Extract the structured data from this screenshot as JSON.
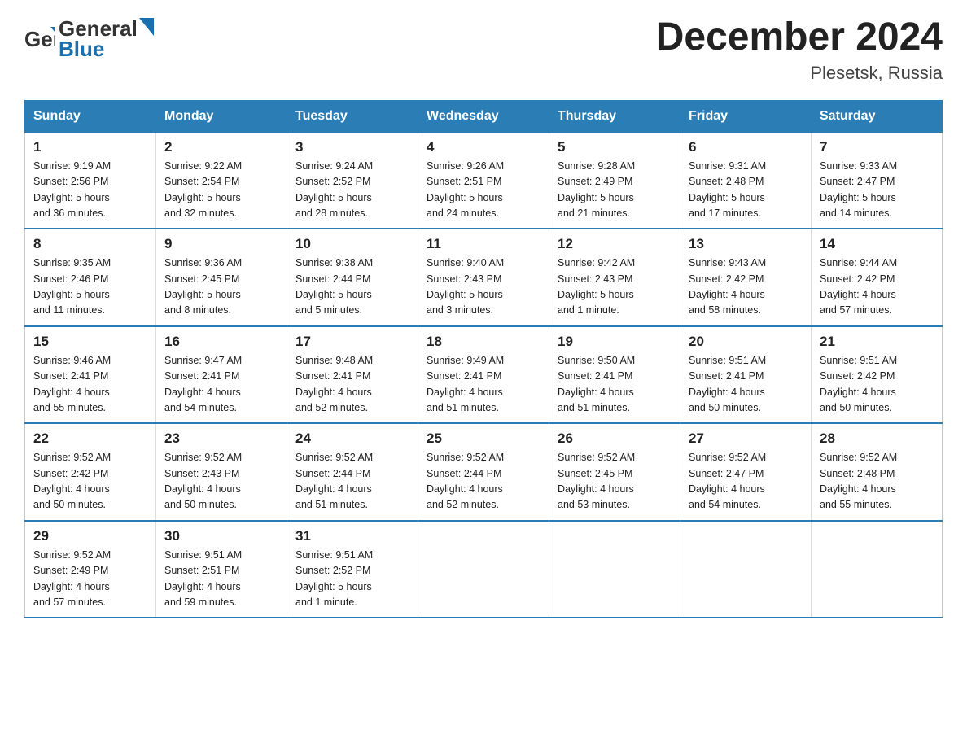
{
  "header": {
    "logo_general": "General",
    "logo_blue": "Blue",
    "month_title": "December 2024",
    "location": "Plesetsk, Russia"
  },
  "days_of_week": [
    "Sunday",
    "Monday",
    "Tuesday",
    "Wednesday",
    "Thursday",
    "Friday",
    "Saturday"
  ],
  "weeks": [
    [
      {
        "day": "1",
        "info": "Sunrise: 9:19 AM\nSunset: 2:56 PM\nDaylight: 5 hours\nand 36 minutes."
      },
      {
        "day": "2",
        "info": "Sunrise: 9:22 AM\nSunset: 2:54 PM\nDaylight: 5 hours\nand 32 minutes."
      },
      {
        "day": "3",
        "info": "Sunrise: 9:24 AM\nSunset: 2:52 PM\nDaylight: 5 hours\nand 28 minutes."
      },
      {
        "day": "4",
        "info": "Sunrise: 9:26 AM\nSunset: 2:51 PM\nDaylight: 5 hours\nand 24 minutes."
      },
      {
        "day": "5",
        "info": "Sunrise: 9:28 AM\nSunset: 2:49 PM\nDaylight: 5 hours\nand 21 minutes."
      },
      {
        "day": "6",
        "info": "Sunrise: 9:31 AM\nSunset: 2:48 PM\nDaylight: 5 hours\nand 17 minutes."
      },
      {
        "day": "7",
        "info": "Sunrise: 9:33 AM\nSunset: 2:47 PM\nDaylight: 5 hours\nand 14 minutes."
      }
    ],
    [
      {
        "day": "8",
        "info": "Sunrise: 9:35 AM\nSunset: 2:46 PM\nDaylight: 5 hours\nand 11 minutes."
      },
      {
        "day": "9",
        "info": "Sunrise: 9:36 AM\nSunset: 2:45 PM\nDaylight: 5 hours\nand 8 minutes."
      },
      {
        "day": "10",
        "info": "Sunrise: 9:38 AM\nSunset: 2:44 PM\nDaylight: 5 hours\nand 5 minutes."
      },
      {
        "day": "11",
        "info": "Sunrise: 9:40 AM\nSunset: 2:43 PM\nDaylight: 5 hours\nand 3 minutes."
      },
      {
        "day": "12",
        "info": "Sunrise: 9:42 AM\nSunset: 2:43 PM\nDaylight: 5 hours\nand 1 minute."
      },
      {
        "day": "13",
        "info": "Sunrise: 9:43 AM\nSunset: 2:42 PM\nDaylight: 4 hours\nand 58 minutes."
      },
      {
        "day": "14",
        "info": "Sunrise: 9:44 AM\nSunset: 2:42 PM\nDaylight: 4 hours\nand 57 minutes."
      }
    ],
    [
      {
        "day": "15",
        "info": "Sunrise: 9:46 AM\nSunset: 2:41 PM\nDaylight: 4 hours\nand 55 minutes."
      },
      {
        "day": "16",
        "info": "Sunrise: 9:47 AM\nSunset: 2:41 PM\nDaylight: 4 hours\nand 54 minutes."
      },
      {
        "day": "17",
        "info": "Sunrise: 9:48 AM\nSunset: 2:41 PM\nDaylight: 4 hours\nand 52 minutes."
      },
      {
        "day": "18",
        "info": "Sunrise: 9:49 AM\nSunset: 2:41 PM\nDaylight: 4 hours\nand 51 minutes."
      },
      {
        "day": "19",
        "info": "Sunrise: 9:50 AM\nSunset: 2:41 PM\nDaylight: 4 hours\nand 51 minutes."
      },
      {
        "day": "20",
        "info": "Sunrise: 9:51 AM\nSunset: 2:41 PM\nDaylight: 4 hours\nand 50 minutes."
      },
      {
        "day": "21",
        "info": "Sunrise: 9:51 AM\nSunset: 2:42 PM\nDaylight: 4 hours\nand 50 minutes."
      }
    ],
    [
      {
        "day": "22",
        "info": "Sunrise: 9:52 AM\nSunset: 2:42 PM\nDaylight: 4 hours\nand 50 minutes."
      },
      {
        "day": "23",
        "info": "Sunrise: 9:52 AM\nSunset: 2:43 PM\nDaylight: 4 hours\nand 50 minutes."
      },
      {
        "day": "24",
        "info": "Sunrise: 9:52 AM\nSunset: 2:44 PM\nDaylight: 4 hours\nand 51 minutes."
      },
      {
        "day": "25",
        "info": "Sunrise: 9:52 AM\nSunset: 2:44 PM\nDaylight: 4 hours\nand 52 minutes."
      },
      {
        "day": "26",
        "info": "Sunrise: 9:52 AM\nSunset: 2:45 PM\nDaylight: 4 hours\nand 53 minutes."
      },
      {
        "day": "27",
        "info": "Sunrise: 9:52 AM\nSunset: 2:47 PM\nDaylight: 4 hours\nand 54 minutes."
      },
      {
        "day": "28",
        "info": "Sunrise: 9:52 AM\nSunset: 2:48 PM\nDaylight: 4 hours\nand 55 minutes."
      }
    ],
    [
      {
        "day": "29",
        "info": "Sunrise: 9:52 AM\nSunset: 2:49 PM\nDaylight: 4 hours\nand 57 minutes."
      },
      {
        "day": "30",
        "info": "Sunrise: 9:51 AM\nSunset: 2:51 PM\nDaylight: 4 hours\nand 59 minutes."
      },
      {
        "day": "31",
        "info": "Sunrise: 9:51 AM\nSunset: 2:52 PM\nDaylight: 5 hours\nand 1 minute."
      },
      {
        "day": "",
        "info": ""
      },
      {
        "day": "",
        "info": ""
      },
      {
        "day": "",
        "info": ""
      },
      {
        "day": "",
        "info": ""
      }
    ]
  ]
}
